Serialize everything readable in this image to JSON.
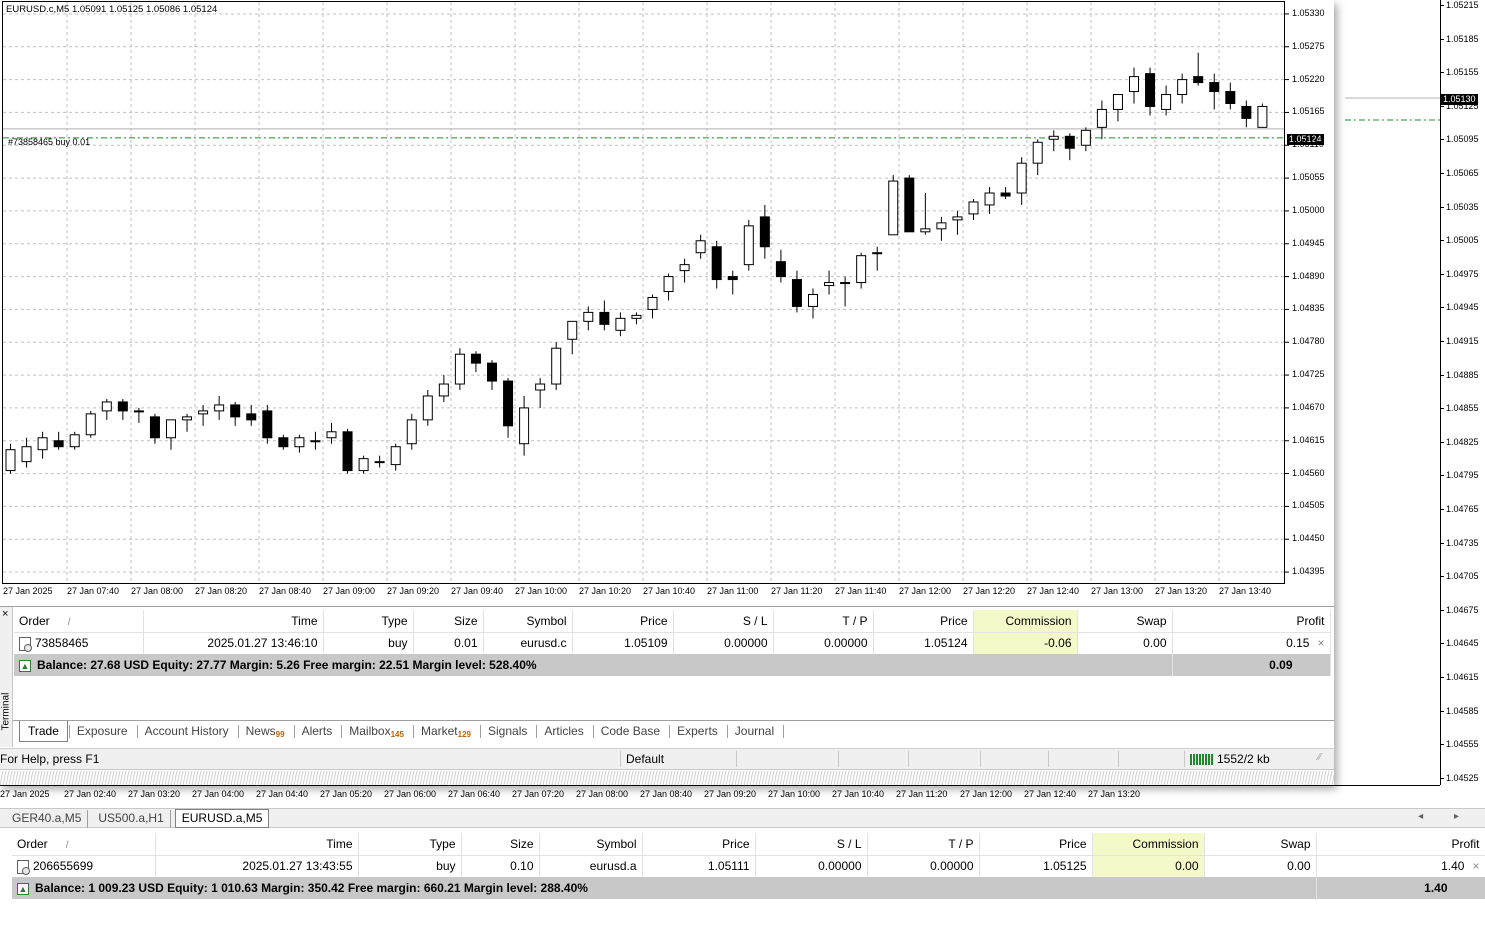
{
  "back_window": {
    "price_ticks": [
      "1.05215",
      "1.05185",
      "1.05155",
      "1.05125",
      "1.05095",
      "1.05065",
      "1.05035",
      "1.05005",
      "1.04975",
      "1.04945",
      "1.04915",
      "1.04885",
      "1.04855",
      "1.04825",
      "1.04795",
      "1.04765",
      "1.04735",
      "1.04705",
      "1.04675",
      "1.04645",
      "1.04615",
      "1.04585",
      "1.04555",
      "1.04525"
    ],
    "bid_label": "1.05130",
    "time_ticks": [
      "27 Jan 2025",
      "27 Jan 02:40",
      "27 Jan 03:20",
      "27 Jan 04:00",
      "27 Jan 04:40",
      "27 Jan 05:20",
      "27 Jan 06:00",
      "27 Jan 06:40",
      "27 Jan 07:20",
      "27 Jan 08:00",
      "27 Jan 08:40",
      "27 Jan 09:20",
      "27 Jan 10:00",
      "27 Jan 10:40",
      "27 Jan 11:20",
      "27 Jan 12:00",
      "27 Jan 12:40",
      "27 Jan 13:20"
    ]
  },
  "front_window": {
    "chart_header": "EURUSD.c,M5  1.05091 1.05125 1.05086 1.05124",
    "order_line_label": "#73858465 buy 0.01",
    "bid_label": "1.05124",
    "price_ticks": [
      "1.05330",
      "1.05275",
      "1.05220",
      "1.05165",
      "1.05110",
      "1.05055",
      "1.05000",
      "1.04945",
      "1.04890",
      "1.04835",
      "1.04780",
      "1.04725",
      "1.04670",
      "1.04615",
      "1.04560",
      "1.04505",
      "1.04450",
      "1.04395"
    ],
    "time_ticks": [
      "27 Jan 2025",
      "27 Jan 07:40",
      "27 Jan 08:00",
      "27 Jan 08:20",
      "27 Jan 08:40",
      "27 Jan 09:00",
      "27 Jan 09:20",
      "27 Jan 09:40",
      "27 Jan 10:00",
      "27 Jan 10:20",
      "27 Jan 10:40",
      "27 Jan 11:00",
      "27 Jan 11:20",
      "27 Jan 11:40",
      "27 Jan 12:00",
      "27 Jan 12:20",
      "27 Jan 12:40",
      "27 Jan 13:00",
      "27 Jan 13:20",
      "27 Jan 13:40"
    ],
    "candles": [
      [
        1.04565,
        1.0461,
        1.0456,
        1.046
      ],
      [
        1.0458,
        1.0462,
        1.0457,
        1.04605
      ],
      [
        1.046,
        1.0463,
        1.04585,
        1.0462
      ],
      [
        1.04615,
        1.0463,
        1.046,
        1.04605
      ],
      [
        1.04605,
        1.0463,
        1.046,
        1.04625
      ],
      [
        1.04625,
        1.04665,
        1.0462,
        1.0466
      ],
      [
        1.04665,
        1.04685,
        1.0465,
        1.0468
      ],
      [
        1.0468,
        1.04685,
        1.0465,
        1.04665
      ],
      [
        1.04665,
        1.0467,
        1.04645,
        1.04665
      ],
      [
        1.04655,
        1.0466,
        1.0461,
        1.0462
      ],
      [
        1.0462,
        1.0465,
        1.046,
        1.0465
      ],
      [
        1.0465,
        1.0466,
        1.0463,
        1.04655
      ],
      [
        1.0466,
        1.04675,
        1.0464,
        1.04665
      ],
      [
        1.04665,
        1.0469,
        1.0465,
        1.04675
      ],
      [
        1.04675,
        1.0468,
        1.0464,
        1.04655
      ],
      [
        1.0466,
        1.04675,
        1.0464,
        1.0465
      ],
      [
        1.04665,
        1.04675,
        1.0461,
        1.0462
      ],
      [
        1.0462,
        1.04625,
        1.046,
        1.04605
      ],
      [
        1.04605,
        1.04625,
        1.04595,
        1.0462
      ],
      [
        1.04615,
        1.0463,
        1.046,
        1.04615
      ],
      [
        1.0462,
        1.04645,
        1.0461,
        1.0463
      ],
      [
        1.0463,
        1.04635,
        1.0456,
        1.04565
      ],
      [
        1.04565,
        1.0459,
        1.0456,
        1.04585
      ],
      [
        1.0458,
        1.0459,
        1.0457,
        1.0458
      ],
      [
        1.04575,
        1.0461,
        1.04565,
        1.04605
      ],
      [
        1.0461,
        1.0466,
        1.046,
        1.0465
      ],
      [
        1.0465,
        1.047,
        1.0464,
        1.0469
      ],
      [
        1.0469,
        1.04725,
        1.0468,
        1.0471
      ],
      [
        1.0471,
        1.0477,
        1.047,
        1.0476
      ],
      [
        1.0476,
        1.04765,
        1.0473,
        1.04745
      ],
      [
        1.04745,
        1.0475,
        1.047,
        1.04715
      ],
      [
        1.04715,
        1.0472,
        1.0462,
        1.0464
      ],
      [
        1.0461,
        1.0469,
        1.0459,
        1.0467
      ],
      [
        1.047,
        1.0472,
        1.0467,
        1.0471
      ],
      [
        1.0471,
        1.0478,
        1.047,
        1.0477
      ],
      [
        1.04785,
        1.0481,
        1.0476,
        1.04815
      ],
      [
        1.04815,
        1.0484,
        1.048,
        1.0483
      ],
      [
        1.0483,
        1.0485,
        1.048,
        1.0481
      ],
      [
        1.048,
        1.0483,
        1.0479,
        1.0482
      ],
      [
        1.0482,
        1.0483,
        1.0481,
        1.04825
      ],
      [
        1.04835,
        1.0486,
        1.0482,
        1.04855
      ],
      [
        1.04865,
        1.04895,
        1.0485,
        1.0489
      ],
      [
        1.049,
        1.0492,
        1.0488,
        1.0491
      ],
      [
        1.0493,
        1.0496,
        1.0492,
        1.0495
      ],
      [
        1.0494,
        1.0495,
        1.0487,
        1.04885
      ],
      [
        1.0489,
        1.049,
        1.0486,
        1.04885
      ],
      [
        1.0491,
        1.04985,
        1.049,
        1.04975
      ],
      [
        1.0499,
        1.0501,
        1.0492,
        1.0494
      ],
      [
        1.04915,
        1.04935,
        1.0488,
        1.0489
      ],
      [
        1.04885,
        1.049,
        1.0483,
        1.0484
      ],
      [
        1.0484,
        1.0487,
        1.0482,
        1.0486
      ],
      [
        1.04875,
        1.049,
        1.0486,
        1.0488
      ],
      [
        1.0488,
        1.0489,
        1.0484,
        1.0488
      ],
      [
        1.0488,
        1.0493,
        1.0487,
        1.04925
      ],
      [
        1.0493,
        1.0494,
        1.049,
        1.0493
      ],
      [
        1.0496,
        1.0506,
        1.0496,
        1.0505
      ],
      [
        1.05055,
        1.0506,
        1.0498,
        1.04965
      ],
      [
        1.04965,
        1.0503,
        1.0496,
        1.0497
      ],
      [
        1.0497,
        1.0499,
        1.0495,
        1.0498
      ],
      [
        1.04985,
        1.05,
        1.0496,
        1.0499
      ],
      [
        1.04995,
        1.0502,
        1.04985,
        1.05015
      ],
      [
        1.0501,
        1.0504,
        1.04995,
        1.0503
      ],
      [
        1.0503,
        1.0504,
        1.0502,
        1.05025
      ],
      [
        1.0503,
        1.0509,
        1.0501,
        1.0508
      ],
      [
        1.0508,
        1.0512,
        1.0506,
        1.05115
      ],
      [
        1.0512,
        1.05135,
        1.051,
        1.05125
      ],
      [
        1.05125,
        1.0513,
        1.05085,
        1.05105
      ],
      [
        1.0511,
        1.0514,
        1.051,
        1.05135
      ],
      [
        1.0514,
        1.05185,
        1.0512,
        1.0517
      ],
      [
        1.0517,
        1.05195,
        1.0515,
        1.05195
      ],
      [
        1.052,
        1.0524,
        1.0518,
        1.05225
      ],
      [
        1.0523,
        1.0524,
        1.0516,
        1.05175
      ],
      [
        1.0517,
        1.0521,
        1.0516,
        1.05195
      ],
      [
        1.05195,
        1.0523,
        1.0518,
        1.0522
      ],
      [
        1.05225,
        1.05265,
        1.0521,
        1.05215
      ],
      [
        1.05215,
        1.0523,
        1.0517,
        1.052
      ],
      [
        1.052,
        1.05215,
        1.0517,
        1.0518
      ],
      [
        1.05175,
        1.05185,
        1.0514,
        1.05155
      ],
      [
        1.0514,
        1.0518,
        1.0514,
        1.05175
      ]
    ]
  },
  "terminal": {
    "columns": [
      "Order",
      "Time",
      "Type",
      "Size",
      "Symbol",
      "Price",
      "S / L",
      "T / P",
      "Price",
      "Commission",
      "Swap",
      "Profit"
    ],
    "sort_mark": "/",
    "row": {
      "order": "73858465",
      "time": "2025.01.27 13:46:10",
      "type": "buy",
      "size": "0.01",
      "symbol": "eurusd.c",
      "price": "1.05109",
      "sl": "0.00000",
      "tp": "0.00000",
      "cur_price": "1.05124",
      "commission": "-0.06",
      "swap": "0.00",
      "profit": "0.15"
    },
    "balance_text": "Balance: 27.68 USD  Equity: 27.77  Margin: 5.26  Free margin: 22.51  Margin level: 528.40%",
    "balance_profit": "0.09",
    "side_label": "Terminal",
    "close_glyph": "×",
    "row_close_glyph": "×",
    "tabs": [
      {
        "label": "Trade",
        "badge": ""
      },
      {
        "label": "Exposure",
        "badge": ""
      },
      {
        "label": "Account History",
        "badge": ""
      },
      {
        "label": "News",
        "badge": "99"
      },
      {
        "label": "Alerts",
        "badge": ""
      },
      {
        "label": "Mailbox",
        "badge": "145"
      },
      {
        "label": "Market",
        "badge": "129"
      },
      {
        "label": "Signals",
        "badge": ""
      },
      {
        "label": "Articles",
        "badge": ""
      },
      {
        "label": "Code Base",
        "badge": ""
      },
      {
        "label": "Experts",
        "badge": ""
      },
      {
        "label": "Journal",
        "badge": ""
      }
    ]
  },
  "status_bar": {
    "help": "For Help, press F1",
    "profile": "Default",
    "traffic": "1552/2 kb"
  },
  "chart_tabs": {
    "items": [
      "GER40.a,M5",
      "US500.a,H1",
      "EURUSD.a,M5"
    ],
    "active_index": 2,
    "arrows": "◂ ▸"
  },
  "terminal2": {
    "columns": [
      "Order",
      "Time",
      "Type",
      "Size",
      "Symbol",
      "Price",
      "S / L",
      "T / P",
      "Price",
      "Commission",
      "Swap",
      "Profit"
    ],
    "sort_mark": "/",
    "row": {
      "order": "206655699",
      "time": "2025.01.27 13:43:55",
      "type": "buy",
      "size": "0.10",
      "symbol": "eurusd.a",
      "price": "1.05111",
      "sl": "0.00000",
      "tp": "0.00000",
      "cur_price": "1.05125",
      "commission": "0.00",
      "swap": "0.00",
      "profit": "1.40"
    },
    "balance_text": "Balance: 1 009.23 USD  Equity: 1 010.63  Margin: 350.42  Free margin: 660.21  Margin level: 288.40%",
    "balance_profit": "1.40",
    "row_close_glyph": "×"
  },
  "colors": {
    "order_line": "#1e8a2a",
    "grid": "#c0c0c0",
    "bull": "#ffffff",
    "bear": "#000000",
    "commission_bg": "#f5f9c9",
    "balance_bg": "#c8c8c8"
  }
}
